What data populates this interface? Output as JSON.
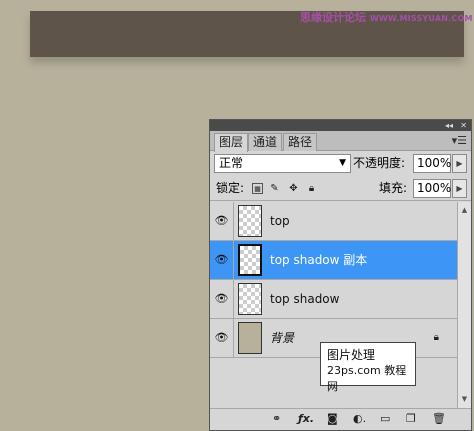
{
  "watermark_top": {
    "text": "思缘设计论坛",
    "url": "WWW.MISSYUAN.COM"
  },
  "panel": {
    "collapse_glyph": "◂◂",
    "close_glyph": "✕",
    "tabs": [
      {
        "label": "图层",
        "active": true
      },
      {
        "label": "通道",
        "active": false
      },
      {
        "label": "路径",
        "active": false
      }
    ],
    "blend_mode": "正常",
    "opacity_label": "不透明度:",
    "opacity_value": "100%",
    "lock_label": "锁定:",
    "fill_label": "填充:",
    "fill_value": "100%",
    "layers": [
      {
        "name": "top",
        "thumb": "transparent",
        "selected": false
      },
      {
        "name": "top shadow 副本",
        "thumb": "transparent",
        "selected": true
      },
      {
        "name": "top shadow",
        "thumb": "transparent",
        "selected": false
      },
      {
        "name": "背景",
        "thumb": "solid",
        "selected": false,
        "locked": true
      }
    ],
    "footer_icons": [
      "link-icon",
      "fx-icon",
      "mask-icon",
      "adjustment-icon",
      "group-icon",
      "new-layer-icon",
      "trash-icon"
    ]
  },
  "watermark_box": {
    "line1": "图片处理",
    "line2": "23ps.com 教程网"
  },
  "colors": {
    "selected_layer": "#3d96f5",
    "canvas_bar": "#5f5449",
    "canvas_bg": "#b7b19c"
  }
}
